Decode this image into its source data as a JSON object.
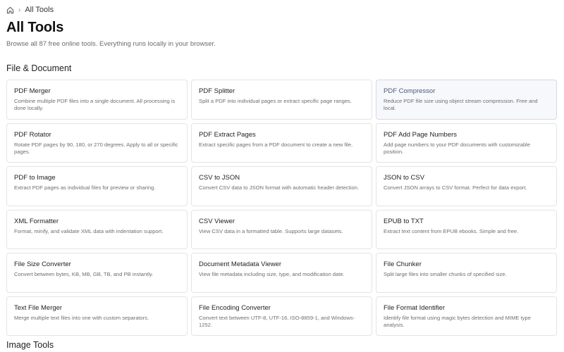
{
  "breadcrumb": {
    "home_icon": "home-icon",
    "separator": "›",
    "current": "All Tools"
  },
  "header": {
    "title": "All Tools",
    "subtitle": "Browse all 87 free online tools. Everything runs locally in your browser."
  },
  "sections": [
    {
      "title": "File & Document",
      "tools": [
        {
          "title": "PDF Merger",
          "desc": "Combine multiple PDF files into a single document. All processing is done locally."
        },
        {
          "title": "PDF Splitter",
          "desc": "Split a PDF into individual pages or extract specific page ranges."
        },
        {
          "title": "PDF Compressor",
          "desc": "Reduce PDF file size using object stream compression. Free and local."
        },
        {
          "title": "PDF Rotator",
          "desc": "Rotate PDF pages by 90, 180, or 270 degrees. Apply to all or specific pages."
        },
        {
          "title": "PDF Extract Pages",
          "desc": "Extract specific pages from a PDF document to create a new file."
        },
        {
          "title": "PDF Add Page Numbers",
          "desc": "Add page numbers to your PDF documents with customizable position."
        },
        {
          "title": "PDF to Image",
          "desc": "Extract PDF pages as individual files for preview or sharing."
        },
        {
          "title": "CSV to JSON",
          "desc": "Convert CSV data to JSON format with automatic header detection."
        },
        {
          "title": "JSON to CSV",
          "desc": "Convert JSON arrays to CSV format. Perfect for data export."
        },
        {
          "title": "XML Formatter",
          "desc": "Format, minify, and validate XML data with indentation support."
        },
        {
          "title": "CSV Viewer",
          "desc": "View CSV data in a formatted table. Supports large datasets."
        },
        {
          "title": "EPUB to TXT",
          "desc": "Extract text content from EPUB ebooks. Simple and free."
        },
        {
          "title": "File Size Converter",
          "desc": "Convert between bytes, KB, MB, GB, TB, and PB instantly."
        },
        {
          "title": "Document Metadata Viewer",
          "desc": "View file metadata including size, type, and modification date."
        },
        {
          "title": "File Chunker",
          "desc": "Split large files into smaller chunks of specified size."
        },
        {
          "title": "Text File Merger",
          "desc": "Merge multiple text files into one with custom separators."
        },
        {
          "title": "File Encoding Converter",
          "desc": "Convert text between UTF-8, UTF-16, ISO-8859-1, and Windows-1252."
        },
        {
          "title": "File Format Identifier",
          "desc": "Identify file format using magic bytes detection and MIME type analysis."
        }
      ]
    },
    {
      "title": "Image Tools",
      "tools": []
    }
  ]
}
